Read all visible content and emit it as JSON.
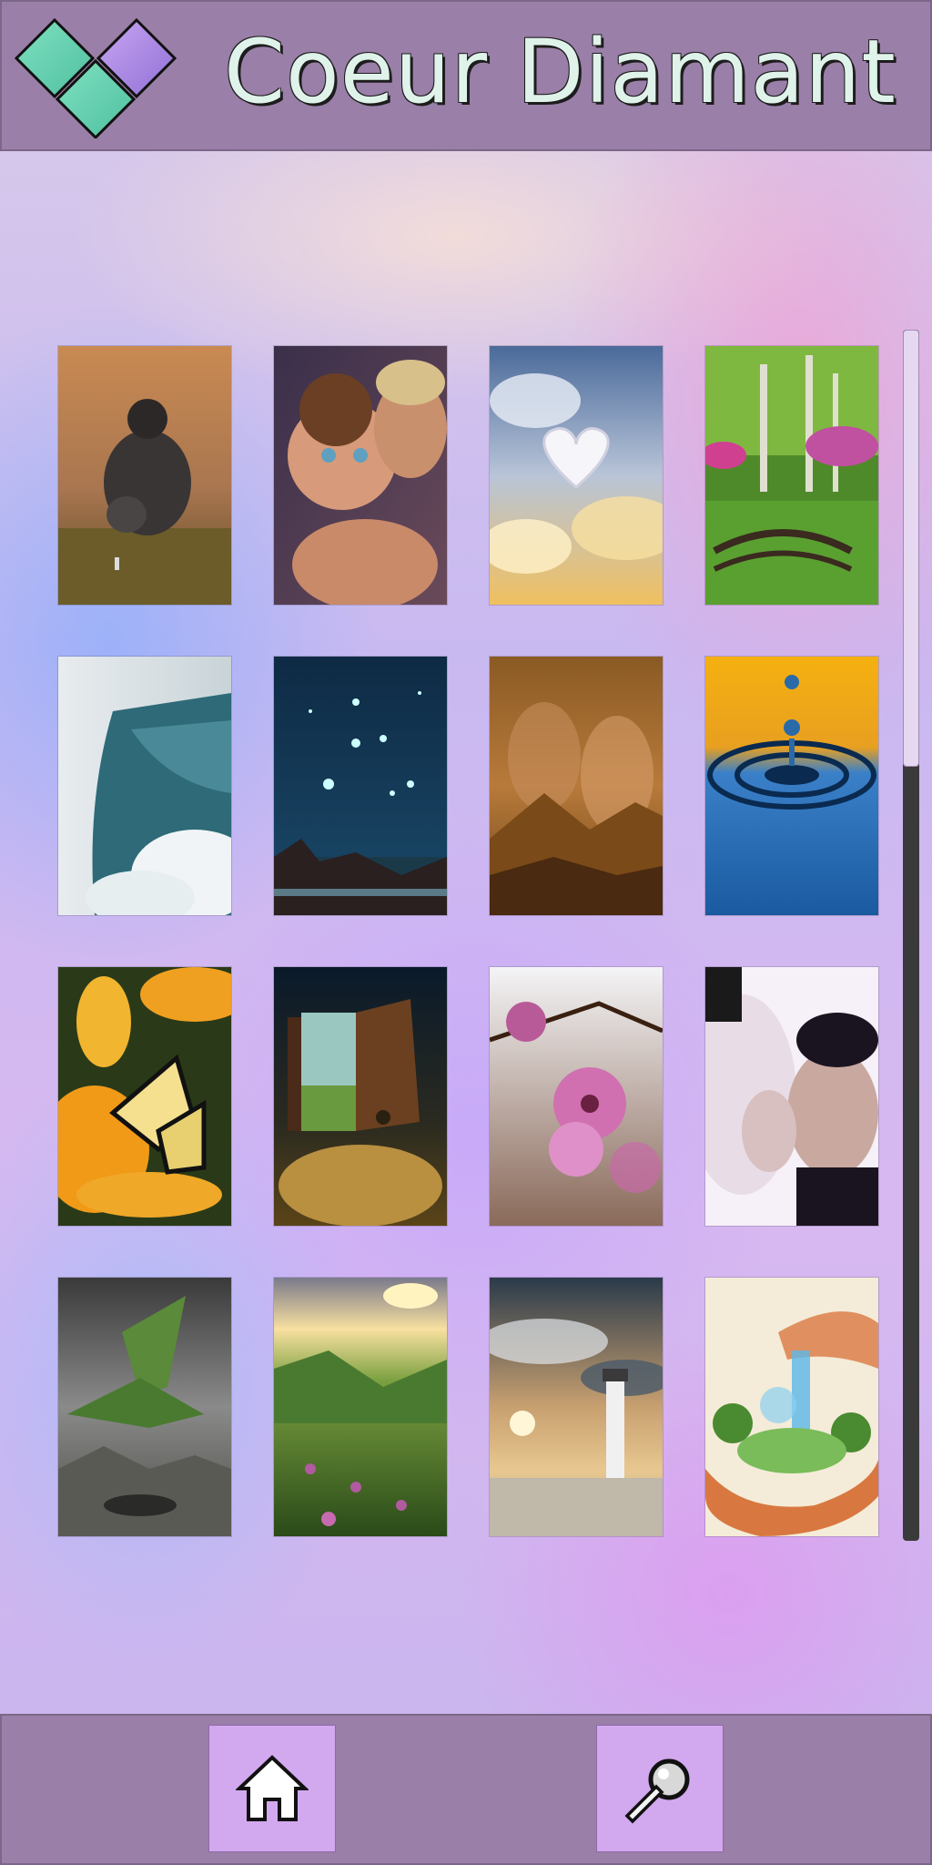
{
  "header": {
    "title": "Coeur Diamant",
    "logo_icon": "heart-diamond-icon"
  },
  "gallery": {
    "items": [
      {
        "name": "gorilla-image"
      },
      {
        "name": "child-embrace-image"
      },
      {
        "name": "heart-cloud-image"
      },
      {
        "name": "garden-bridge-image"
      },
      {
        "name": "waterfall-image"
      },
      {
        "name": "starry-sky-image"
      },
      {
        "name": "couple-mountain-image"
      },
      {
        "name": "water-drop-image"
      },
      {
        "name": "butterfly-flower-image"
      },
      {
        "name": "open-book-image"
      },
      {
        "name": "blossom-image"
      },
      {
        "name": "pregnant-couple-image"
      },
      {
        "name": "dragon-image"
      },
      {
        "name": "meadow-image"
      },
      {
        "name": "lighthouse-image"
      },
      {
        "name": "hands-world-image"
      }
    ]
  },
  "scrollbar": {
    "position": 0
  },
  "footer": {
    "home_icon": "home-icon",
    "search_icon": "search-icon"
  },
  "colors": {
    "bar": "#9a7fa8",
    "button": "#d2a8ef",
    "title_text": "#dff3ea"
  }
}
